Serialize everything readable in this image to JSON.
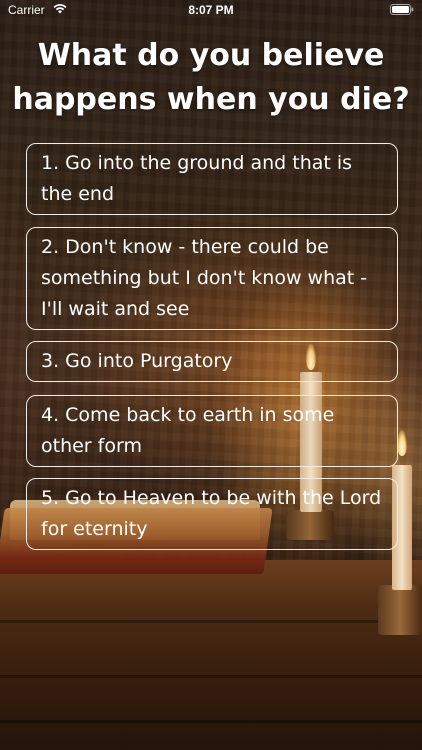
{
  "status_bar": {
    "carrier": "Carrier",
    "time": "8:07 PM",
    "wifi_icon": "wifi-icon",
    "battery_icon": "battery-icon"
  },
  "question": {
    "line1": "What do you believe",
    "line2": "happens when you die?"
  },
  "answers": [
    {
      "label": "1. Go into the ground and that is the end"
    },
    {
      "label": "2. Don't know - there could be something but I don't know what - I'll wait and see"
    },
    {
      "label": "3. Go into Purgatory"
    },
    {
      "label": "4. Come back to earth in some other form"
    },
    {
      "label": "5. Go to Heaven to be with the Lord for eternity"
    }
  ],
  "colors": {
    "text": "#ffffff",
    "button_border": "#f1ece6"
  }
}
